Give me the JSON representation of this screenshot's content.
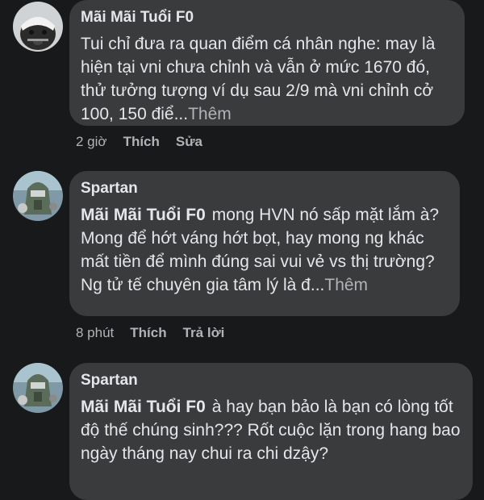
{
  "comments": [
    {
      "author": "Mãi Mãi Tuổi F0",
      "mention": "",
      "text": "Tui chỉ đưa ra quan điểm cá nhân nghe: may là hiện tại vni chưa chỉnh và vẫn ở mức 1670 đó, thử tưởng tượng ví dụ sau 2/9 mà vni chỉnh cở 100, 150 điể...",
      "more": "Thêm",
      "time": "2 giờ",
      "action1": "Thích",
      "action2": "Sửa"
    },
    {
      "author": "Spartan",
      "mention": "Mãi Mãi Tuổi F0",
      "text": "mong HVN nó sấp mặt lắm à? Mong để hớt váng hớt bọt, hay mong ng khác mất tiền để mình đúng sai vui vẻ vs thị trường? Ng tử tế chuyên gia tâm lý là đ...",
      "more": "Thêm",
      "time": "8 phút",
      "action1": "Thích",
      "action2": "Trả lời"
    },
    {
      "author": "Spartan",
      "mention": "Mãi Mãi Tuổi F0",
      "text": "à hay bạn bảo là bạn có lòng tốt độ thế chúng sinh??? Rốt cuộc lặn trong hang bao ngày tháng nay chui ra chi dzậy?"
    }
  ]
}
